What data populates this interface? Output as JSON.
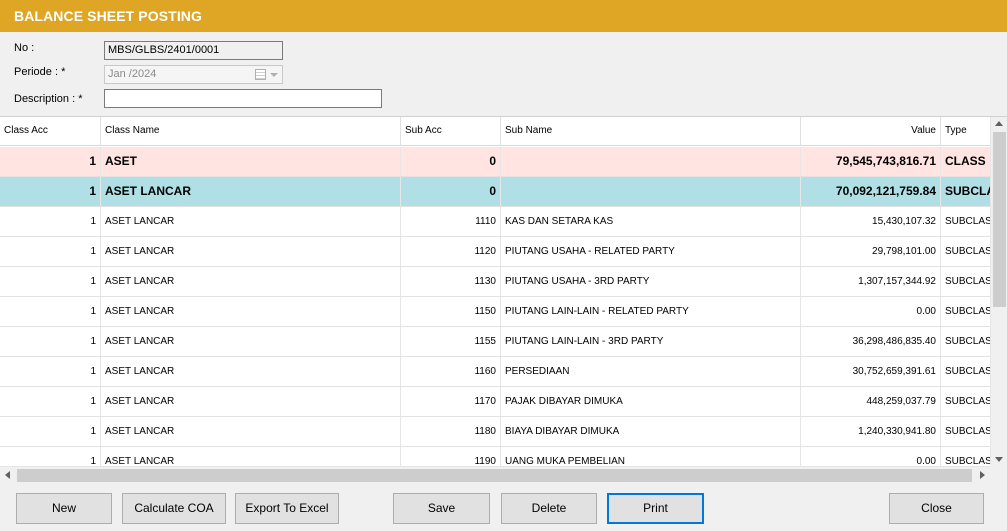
{
  "window": {
    "title": "BALANCE SHEET POSTING"
  },
  "form": {
    "no_label": "No :",
    "no_value": "MBS/GLBS/2401/0001",
    "periode_label": "Periode : *",
    "periode_value": "Jan /2024",
    "description_label": "Description : *",
    "description_value": ""
  },
  "grid": {
    "columns": [
      "Class Acc",
      "Class Name",
      "Sub Acc",
      "Sub Name",
      "Value",
      "Type"
    ],
    "rows": [
      {
        "style": "class",
        "class_acc": "1",
        "class_name": "ASET",
        "sub_acc": "0",
        "sub_name": "",
        "value": "79,545,743,816.71",
        "type": "CLASS"
      },
      {
        "style": "subclass",
        "class_acc": "1",
        "class_name": "ASET LANCAR",
        "sub_acc": "0",
        "sub_name": "",
        "value": "70,092,121,759.84",
        "type": "SUBCLASS"
      },
      {
        "style": "normal",
        "class_acc": "1",
        "class_name": "ASET LANCAR",
        "sub_acc": "1110",
        "sub_name": "KAS DAN SETARA KAS",
        "value": "15,430,107.32",
        "type": "SUBCLASS"
      },
      {
        "style": "normal",
        "class_acc": "1",
        "class_name": "ASET LANCAR",
        "sub_acc": "1120",
        "sub_name": "PIUTANG USAHA - RELATED PARTY",
        "value": "29,798,101.00",
        "type": "SUBCLASS"
      },
      {
        "style": "normal",
        "class_acc": "1",
        "class_name": "ASET LANCAR",
        "sub_acc": "1130",
        "sub_name": "PIUTANG USAHA - 3RD PARTY",
        "value": "1,307,157,344.92",
        "type": "SUBCLASS"
      },
      {
        "style": "normal",
        "class_acc": "1",
        "class_name": "ASET LANCAR",
        "sub_acc": "1150",
        "sub_name": "PIUTANG LAIN-LAIN - RELATED PARTY",
        "value": "0.00",
        "type": "SUBCLASS"
      },
      {
        "style": "normal",
        "class_acc": "1",
        "class_name": "ASET LANCAR",
        "sub_acc": "1155",
        "sub_name": "PIUTANG LAIN-LAIN - 3RD PARTY",
        "value": "36,298,486,835.40",
        "type": "SUBCLASS"
      },
      {
        "style": "normal",
        "class_acc": "1",
        "class_name": "ASET LANCAR",
        "sub_acc": "1160",
        "sub_name": "PERSEDIAAN",
        "value": "30,752,659,391.61",
        "type": "SUBCLASS"
      },
      {
        "style": "normal",
        "class_acc": "1",
        "class_name": "ASET LANCAR",
        "sub_acc": "1170",
        "sub_name": "PAJAK DIBAYAR DIMUKA",
        "value": "448,259,037.79",
        "type": "SUBCLASS"
      },
      {
        "style": "normal",
        "class_acc": "1",
        "class_name": "ASET LANCAR",
        "sub_acc": "1180",
        "sub_name": "BIAYA DIBAYAR DIMUKA",
        "value": "1,240,330,941.80",
        "type": "SUBCLASS"
      },
      {
        "style": "normal",
        "class_acc": "1",
        "class_name": "ASET LANCAR",
        "sub_acc": "1190",
        "sub_name": "UANG MUKA PEMBELIAN",
        "value": "0.00",
        "type": "SUBCLASS"
      }
    ]
  },
  "buttons": {
    "new": "New",
    "calculate_coa": "Calculate COA",
    "export_excel": "Export To Excel",
    "save": "Save",
    "delete": "Delete",
    "print": "Print",
    "close": "Close"
  },
  "colors": {
    "title_bar": "#dea624",
    "class_row": "#ffe4e1",
    "subclass_row": "#b0e0e6",
    "focus_border": "#0078d7"
  }
}
